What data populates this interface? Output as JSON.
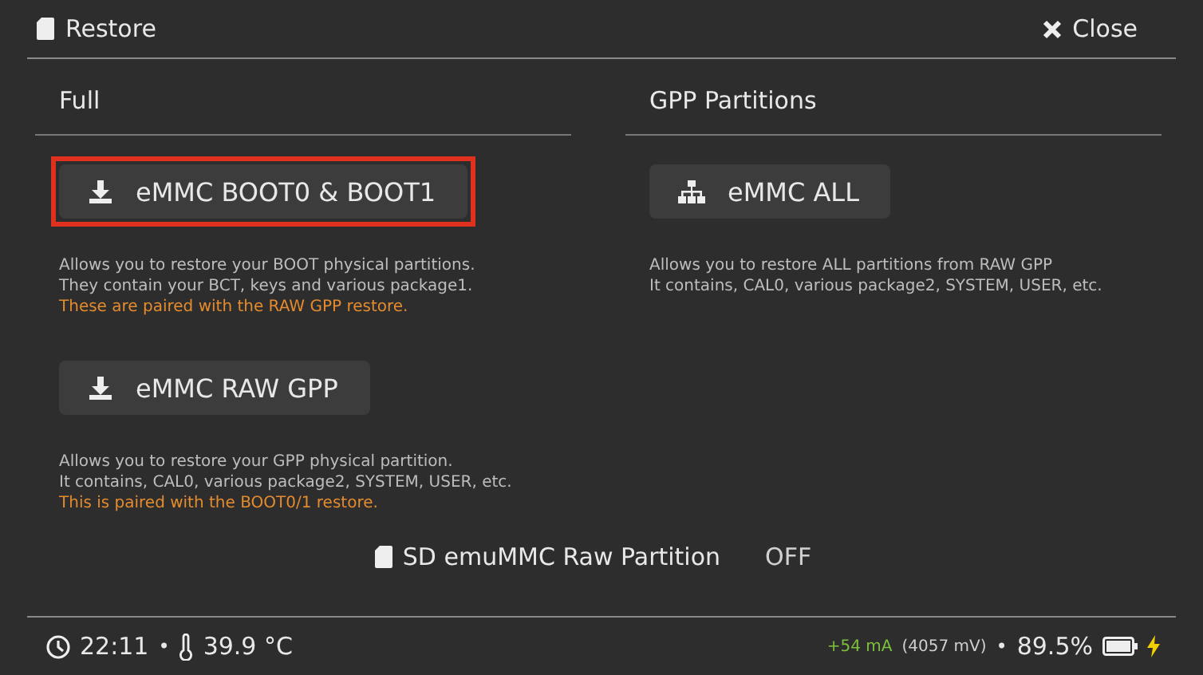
{
  "window": {
    "title": "Restore",
    "close_label": "Close"
  },
  "sections": [
    {
      "title": "Full",
      "items": [
        {
          "button": {
            "label": "eMMC BOOT0 & BOOT1",
            "kind": "single",
            "selected": true
          },
          "description": [
            {
              "text": "Allows you to restore your BOOT physical partitions.",
              "kind": "note"
            },
            {
              "text": "They contain your BCT, keys and various package1.",
              "kind": "note"
            },
            {
              "text": "These are paired with the RAW GPP restore.",
              "kind": "warning"
            }
          ]
        },
        {
          "button": {
            "label": "eMMC RAW GPP",
            "kind": "single",
            "selected": false
          },
          "description": [
            {
              "text": "Allows you to restore your GPP physical partition.",
              "kind": "note"
            },
            {
              "text": "It contains, CAL0, various package2, SYSTEM, USER, etc.",
              "kind": "note"
            },
            {
              "text": "This is paired with the BOOT0/1 restore.",
              "kind": "warning"
            }
          ]
        }
      ]
    },
    {
      "title": "GPP Partitions",
      "items": [
        {
          "button": {
            "label": "eMMC ALL",
            "kind": "all",
            "selected": false
          },
          "description": [
            {
              "text": "Allows you to restore ALL partitions from RAW GPP",
              "kind": "note"
            },
            {
              "text": "It contains, CAL0, various package2, SYSTEM, USER, etc.",
              "kind": "note"
            }
          ]
        }
      ]
    }
  ],
  "toggle": {
    "label": "SD emuMMC Raw Partition",
    "value": "OFF"
  },
  "status_bar": {
    "time": "22:11",
    "time_separator": "•",
    "temperature": "39.9 °C",
    "current": "+54 mA",
    "voltage": "(4057 mV)",
    "battery_separator": "•",
    "battery": "89.5%",
    "charging": true
  }
}
